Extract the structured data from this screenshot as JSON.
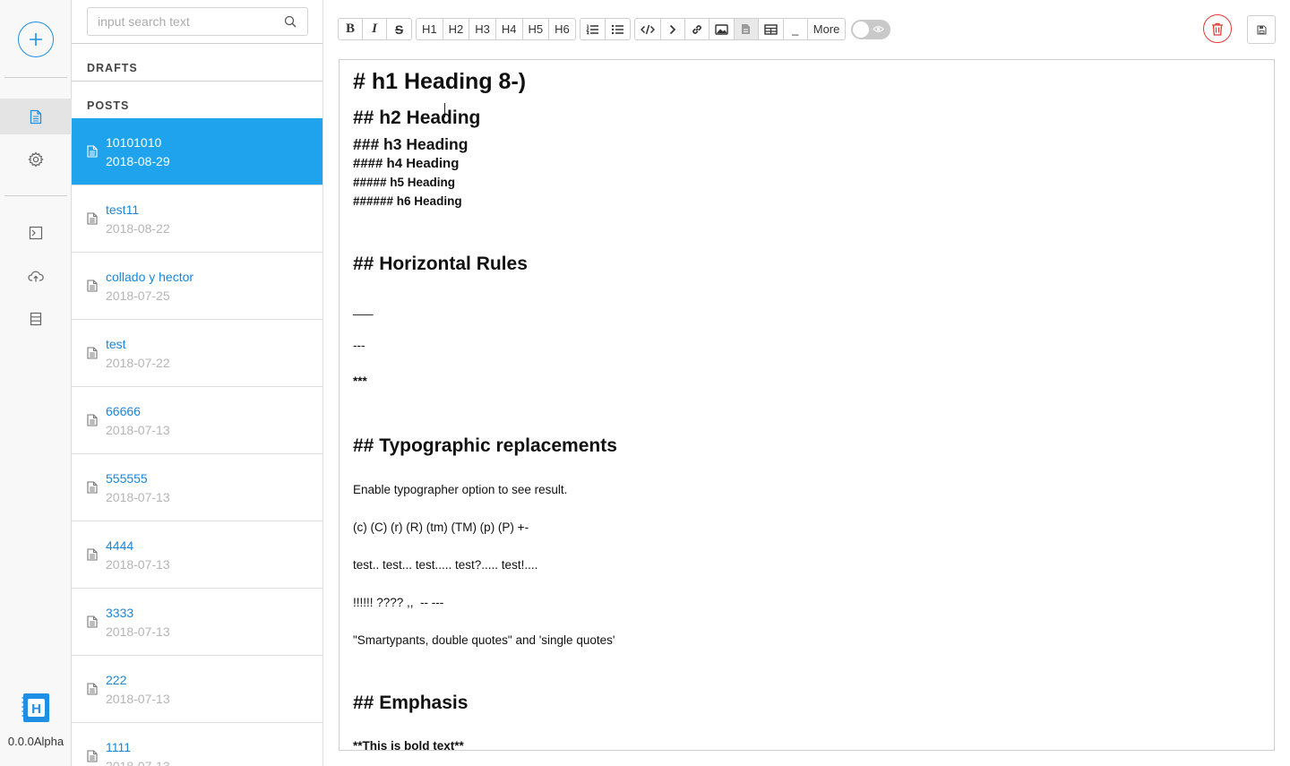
{
  "app": {
    "version": "0.0.0Alpha",
    "logo_letter": "H"
  },
  "rail": {
    "items": [
      {
        "icon": "document-icon",
        "active": true
      },
      {
        "icon": "gear-icon",
        "active": false
      },
      {
        "icon": "terminal-icon",
        "active": false
      },
      {
        "icon": "cloud-upload-icon",
        "active": false
      },
      {
        "icon": "database-icon",
        "active": false
      }
    ]
  },
  "search": {
    "placeholder": "input search text"
  },
  "sections": {
    "drafts": "DRAFTS",
    "posts": "POSTS"
  },
  "posts": [
    {
      "title": "10101010",
      "date": "2018-08-29",
      "active": true
    },
    {
      "title": "test11",
      "date": "2018-08-22",
      "active": false
    },
    {
      "title": "collado y hector",
      "date": "2018-07-25",
      "active": false
    },
    {
      "title": "test",
      "date": "2018-07-22",
      "active": false
    },
    {
      "title": "66666",
      "date": "2018-07-13",
      "active": false
    },
    {
      "title": "555555",
      "date": "2018-07-13",
      "active": false
    },
    {
      "title": "4444",
      "date": "2018-07-13",
      "active": false
    },
    {
      "title": "3333",
      "date": "2018-07-13",
      "active": false
    },
    {
      "title": "222",
      "date": "2018-07-13",
      "active": false
    },
    {
      "title": "1111",
      "date": "2018-07-13",
      "active": false
    }
  ],
  "toolbar": {
    "bold": "B",
    "italic": "I",
    "strike": "S",
    "headings": [
      "H1",
      "H2",
      "H3",
      "H4",
      "H5",
      "H6"
    ],
    "underscore": "_",
    "more": "More"
  },
  "colors": {
    "accent": "#1fa3ec",
    "link": "#1a86d9",
    "delete": "#e53935"
  },
  "editor": {
    "lines": [
      {
        "text": "# h1 Heading 8-)",
        "style": "h1l"
      },
      {
        "text": "## h2 Heading",
        "style": "h2l"
      },
      {
        "text": "### h3 Heading",
        "style": "h3l"
      },
      {
        "text": "#### h4 Heading",
        "style": "h4l"
      },
      {
        "text": "##### h5 Heading",
        "style": "h5l"
      },
      {
        "text": "###### h6 Heading",
        "style": "h6l"
      },
      {
        "text": "## Horizontal Rules",
        "style": "h2l"
      },
      {
        "text": "___",
        "style": "pl"
      },
      {
        "text": "---",
        "style": "pl"
      },
      {
        "text": "***",
        "style": "bl"
      },
      {
        "text": "## Typographic replacements",
        "style": "h2l"
      },
      {
        "text": "Enable typographer option to see result.",
        "style": "pl"
      },
      {
        "text": "(c) (C) (r) (R) (tm) (TM) (p) (P) +-",
        "style": "pl"
      },
      {
        "text": "test.. test... test..... test?..... test!....",
        "style": "pl"
      },
      {
        "text": "!!!!!! ???? ,,  -- ---",
        "style": "pl"
      },
      {
        "text": "\"Smartypants, double quotes\" and 'single quotes'",
        "style": "pl"
      },
      {
        "text": "## Emphasis",
        "style": "h2l"
      },
      {
        "text": "**This is bold text**",
        "style": "bl"
      }
    ]
  }
}
